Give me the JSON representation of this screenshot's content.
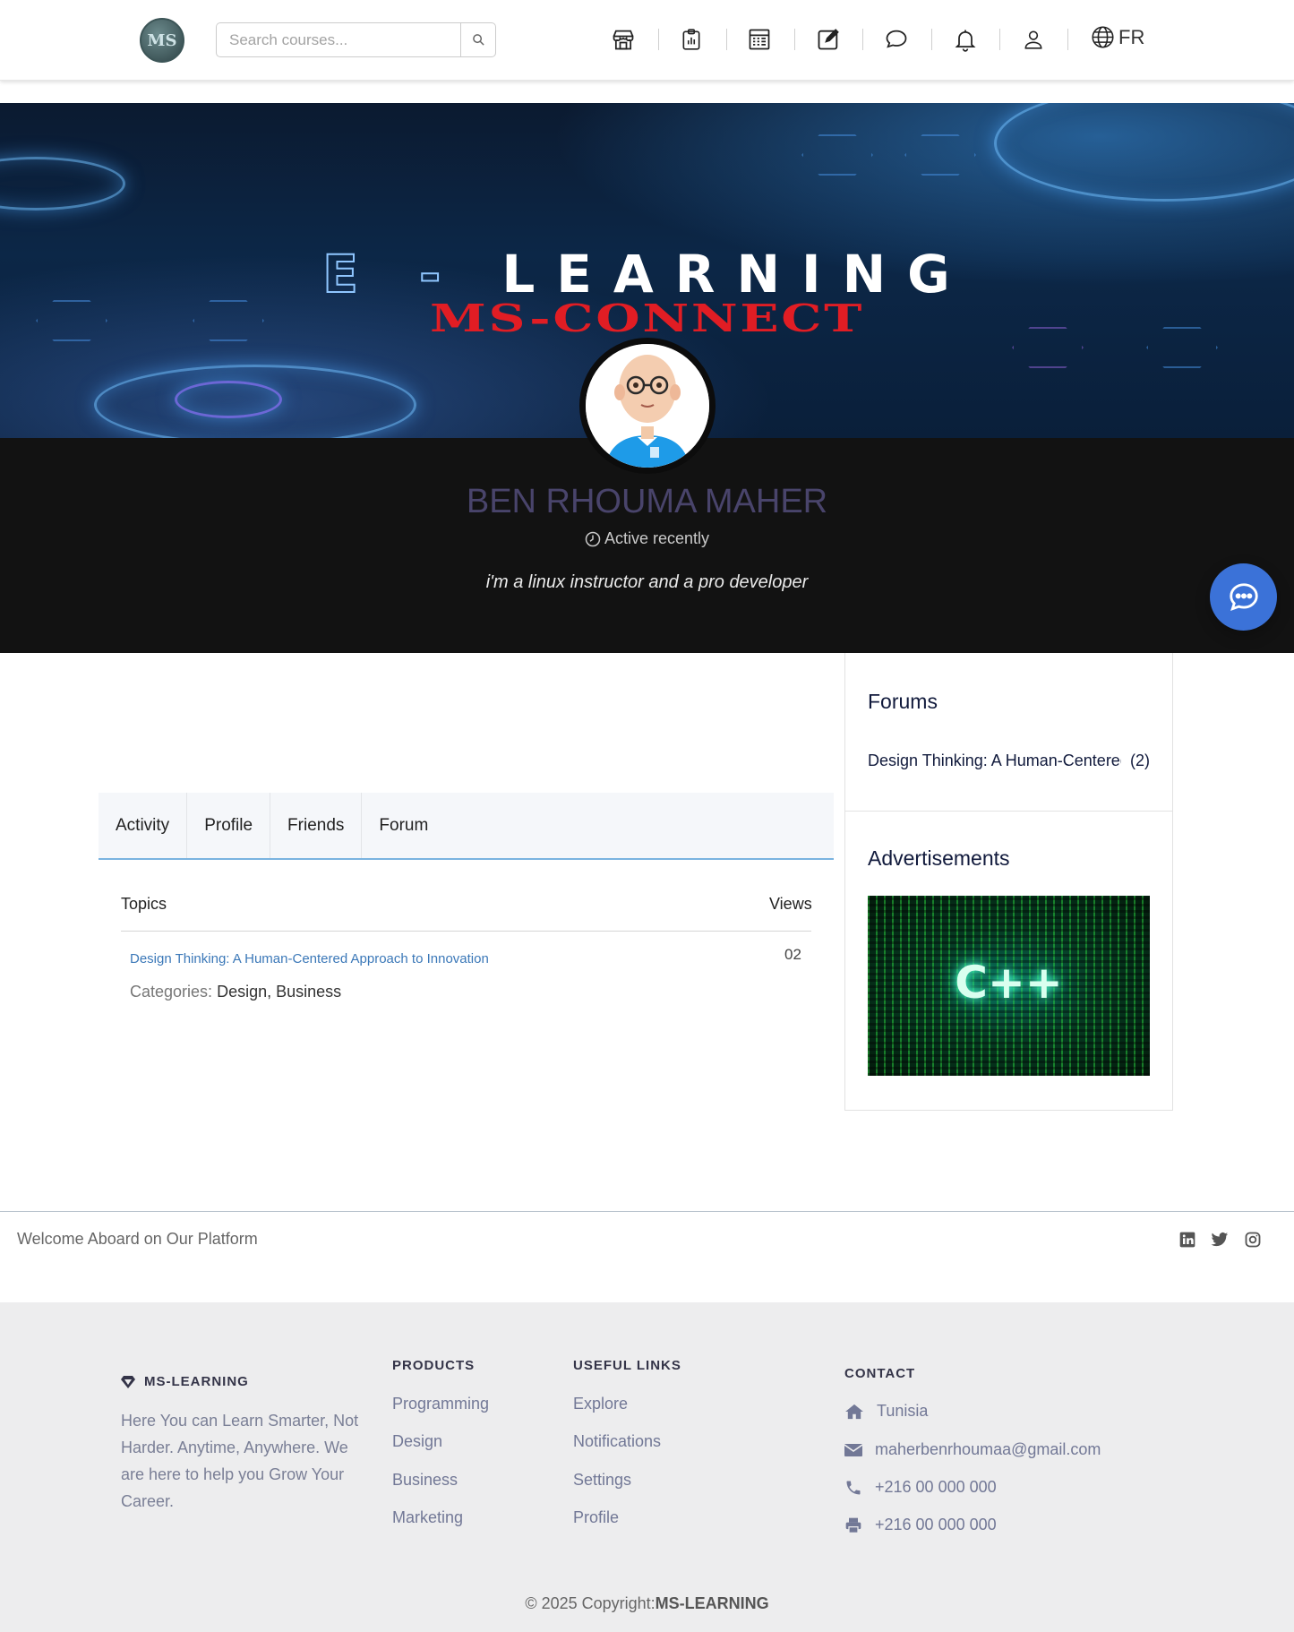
{
  "header": {
    "logo_text": "MS",
    "search_placeholder": "Search courses...",
    "nav_icons": [
      "store-icon",
      "clipboard-chart-icon",
      "calculator-icon",
      "edit-icon",
      "chat-icon",
      "bell-icon",
      "user-icon"
    ],
    "language": "FR"
  },
  "banner": {
    "title_prefix": "E -",
    "title_main": "LEARNING",
    "subtitle": "MS-CONNECT"
  },
  "profile": {
    "name": "BEN RHOUMA MAHER",
    "status": "Active recently",
    "bio": "i'm a linux instructor and a pro developer"
  },
  "tabs": [
    "Activity",
    "Profile",
    "Friends",
    "Forum"
  ],
  "topics": {
    "header_topics": "Topics",
    "header_views": "Views",
    "rows": [
      {
        "title": "Design Thinking: A Human-Centered Approach to Innovation",
        "views": "02",
        "categories_label": "Categories:",
        "categories": [
          "Design",
          "Business"
        ]
      }
    ]
  },
  "sidebar": {
    "forums_title": "Forums",
    "forums": [
      {
        "title": "Design Thinking: A Human-Centered Approach to Innovation",
        "count": "(2)"
      }
    ],
    "ads_title": "Advertisements",
    "ad_text": "C++"
  },
  "footer": {
    "welcome": "Welcome Aboard on Our Platform",
    "social_icons": [
      "linkedin-icon",
      "twitter-icon",
      "instagram-icon"
    ],
    "brand": "MS-LEARNING",
    "brand_text": "Here You can Learn Smarter, Not Harder. Anytime, Anywhere. We are here to help you Grow Your Career.",
    "products_title": "PRODUCTS",
    "products": [
      "Programming",
      "Design",
      "Business",
      "Marketing"
    ],
    "useful_title": "USEFUL LINKS",
    "useful": [
      "Explore",
      "Notifications",
      "Settings",
      "Profile"
    ],
    "contact_title": "CONTACT",
    "contact": {
      "address": "Tunisia",
      "email": "maherbenrhoumaa@gmail.com",
      "phone": "+216 00 000 000",
      "fax": "+216 00 000 000"
    },
    "copyright_prefix": "© 2025 Copyright:",
    "copyright_brand": "MS-LEARNING"
  },
  "colors": {
    "accent_blue": "#3b72d8",
    "link_blue": "#3b78b8",
    "banner_red": "#e11d24",
    "name_purple": "#49446b"
  }
}
